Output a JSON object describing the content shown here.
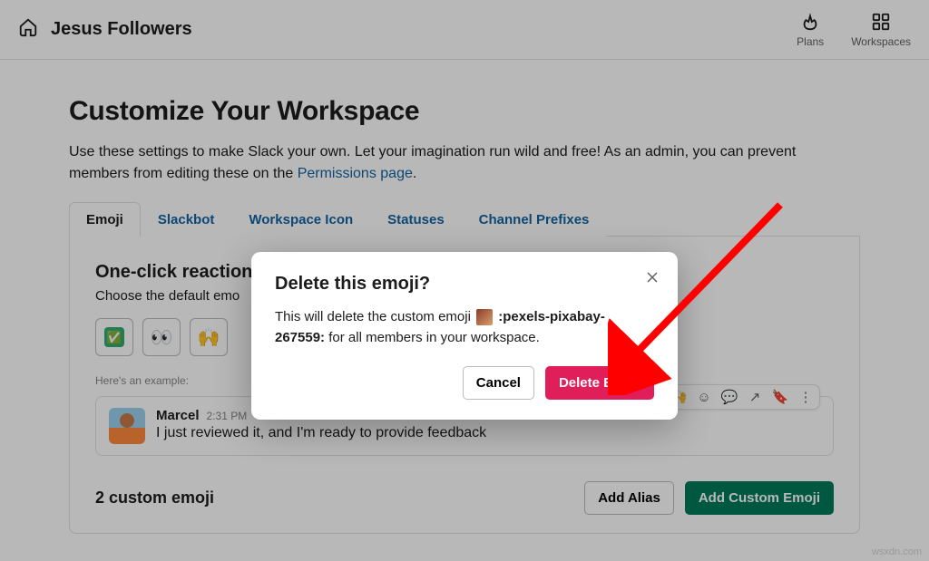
{
  "topbar": {
    "workspace_name": "Jesus Followers",
    "plans_label": "Plans",
    "workspaces_label": "Workspaces"
  },
  "page": {
    "title": "Customize Your Workspace",
    "desc_a": "Use these settings to make Slack your own. Let your imagination run wild and free! As an admin, you can prevent members from editing these on the ",
    "desc_link": "Permissions page",
    "desc_b": "."
  },
  "tabs": {
    "emoji": "Emoji",
    "slackbot": "Slackbot",
    "icon": "Workspace Icon",
    "statuses": "Statuses",
    "prefixes": "Channel Prefixes"
  },
  "section": {
    "title": "One-click reactions",
    "sub": "Choose the default emo",
    "example_label": "Here's an example:"
  },
  "emojis": {
    "check": "✅",
    "eyes": "👀",
    "hands": "🙌"
  },
  "message": {
    "author": "Marcel",
    "time": "2:31 PM",
    "body": "I just reviewed it, and I'm ready to provide feedback"
  },
  "footer": {
    "count": "2 custom emoji",
    "add_alias": "Add Alias",
    "add_custom": "Add Custom Emoji"
  },
  "modal": {
    "title": "Delete this emoji?",
    "body_a": "This will delete the custom emoji ",
    "emoji_name": ":pexels-pixabay-267559:",
    "body_b": " for all members in your workspace.",
    "cancel": "Cancel",
    "delete": "Delete Emoji"
  },
  "watermark": "wsxdn.com"
}
